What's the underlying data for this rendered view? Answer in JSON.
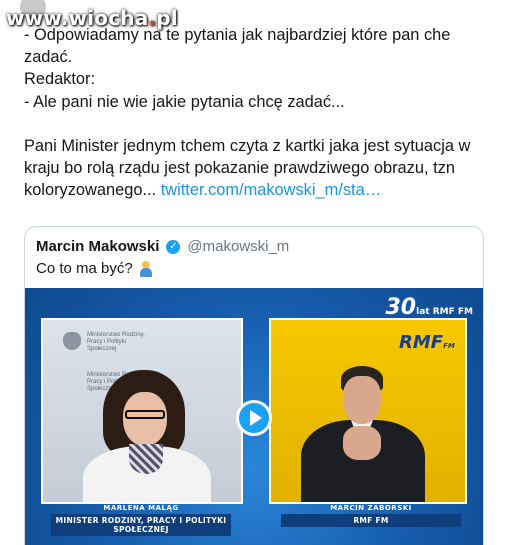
{
  "watermark": {
    "prefix": "www.",
    "name": "wiocha",
    "dot": ".",
    "tld": "pl"
  },
  "tweet": {
    "lines": [
      "- Odpowiadamy na te pytania jak najbardziej które pan che zadać.",
      "Redaktor:",
      "- Ale pani nie wie jakie pytania chcę zadać...",
      "",
      "Pani Minister jednym tchem czyta z kartki jaka jest sytuacja w kraju bo rolą rządu jest pokazanie prawdziwego obrazu, tzn koloryzowanego..."
    ],
    "link": "twitter.com/makowski_m/sta…"
  },
  "quote": {
    "name": "Marcin Makowski",
    "handle": "@makowski_m",
    "text": "Co to ma być?",
    "emoji_icon": "person-shrugging-icon"
  },
  "video": {
    "logo": "30",
    "logo_suffix": "lat RMF FM",
    "left_panel": {
      "ministry_text": "Ministerstwo Rodziny, Pracy i Polityki Społecznej",
      "ministry_text_2": "Ministerstwo Rodziny, Pracy i Polityki Społecznej",
      "caption_name": "MARLENA MALĄG",
      "caption_role": "MINISTER RODZINY, PRACY I POLITYKI SPOŁECZNEJ"
    },
    "right_panel": {
      "rmf_logo": "RMF",
      "rmf_logo_small": "FM",
      "caption_name": "MARCIN ZABORSKI",
      "caption_role": "RMF FM"
    },
    "play_icon": "play-icon"
  },
  "colors": {
    "link": "#1b95e0",
    "verified": "#1da1f2",
    "video_bg": "#1664b4",
    "rmf_yellow": "#f6c400"
  }
}
